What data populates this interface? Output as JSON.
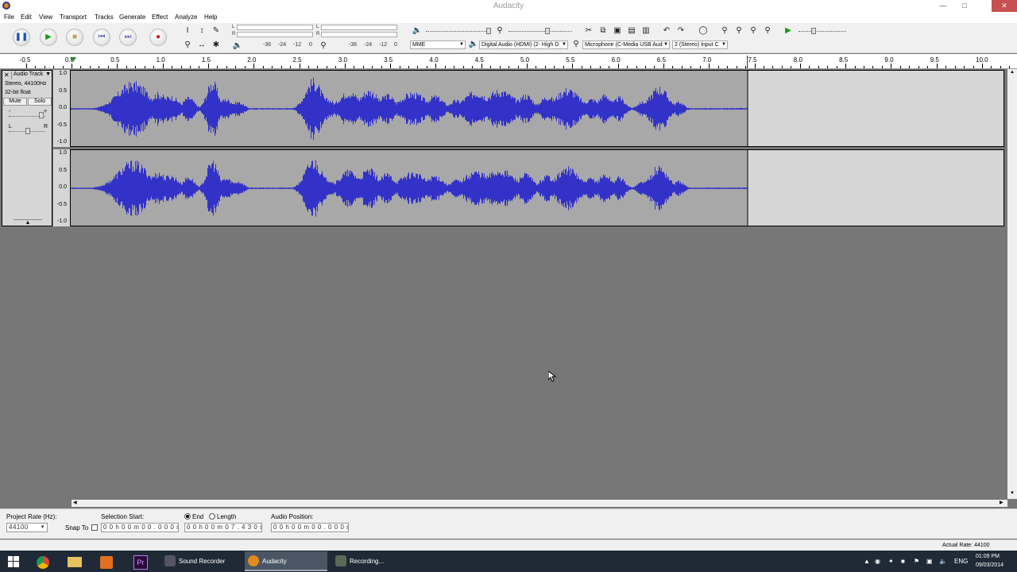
{
  "window": {
    "title": "Audacity"
  },
  "menu": [
    "File",
    "Edit",
    "View",
    "Transport",
    "Tracks",
    "Generate",
    "Effect",
    "Analyze",
    "Help"
  ],
  "meters": {
    "playback_scale": [
      "-36",
      "-24",
      "-12",
      "0"
    ],
    "record_scale": [
      "-36",
      "-24",
      "-12",
      "0"
    ],
    "L": "L",
    "R": "R"
  },
  "devices": {
    "host": "MME",
    "output": "Digital Audio (HDMI) (2- High D",
    "input": "Microphone (C-Media USB Aud",
    "channels": "2 (Stereo) Input C"
  },
  "ruler": {
    "labels": [
      "-0.5",
      "0.0",
      "0.5",
      "1.0",
      "1.5",
      "2.0",
      "2.5",
      "3.0",
      "3.5",
      "4.0",
      "4.5",
      "5.0",
      "5.5",
      "6.0",
      "6.5",
      "7.0",
      "7.5",
      "8.0",
      "8.5",
      "9.0",
      "9.5",
      "10.0"
    ]
  },
  "track": {
    "name": "Audio Track",
    "rate": "Stereo, 44100Hz",
    "format": "32-bit float",
    "mute": "Mute",
    "solo": "Solo",
    "gain_minus": "-",
    "gain_plus": "+",
    "pan_L": "L",
    "pan_R": "R",
    "scale": [
      "1.0",
      "0.5",
      "0.0",
      "-0.5",
      "-1.0"
    ]
  },
  "selection": {
    "project_rate_label": "Project Rate (Hz):",
    "project_rate": "44100",
    "snap_to": "Snap To",
    "selection_start_label": "Selection Start:",
    "selection_start": "0 0 h 0 0 m 0 0 . 0 0 0 s",
    "end_label": "End",
    "length_label": "Length",
    "end_value": "0 0 h 0 0 m 0 7 . 4 3 0 s",
    "audio_position_label": "Audio Position:",
    "audio_position": "0 0 h 0 0 m 0 0 . 0 0 0 s"
  },
  "status": {
    "actual_rate": "Actual Rate: 44100"
  },
  "taskbar": {
    "tasks": [
      "Sound Recorder",
      "Audacity",
      "Recording..."
    ],
    "lang": "ENG",
    "time": "01:09 PM",
    "date": "09/03/2014"
  },
  "colors": {
    "waveform": "#3232c8",
    "track_bg": "#d6d6d6",
    "selected_bg": "#a8a8a8"
  }
}
